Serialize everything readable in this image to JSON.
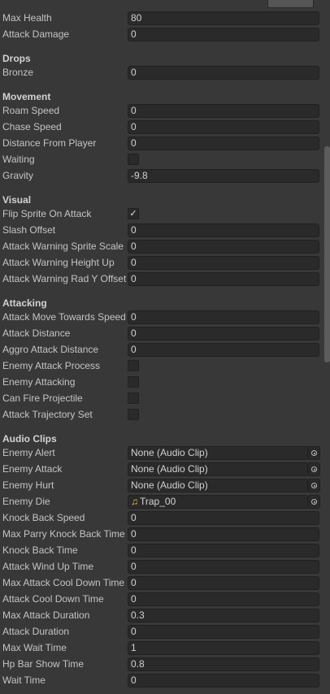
{
  "stats": {
    "max_health_label": "Max Health",
    "max_health_value": "80",
    "attack_damage_label": "Attack Damage",
    "attack_damage_value": "0"
  },
  "drops": {
    "header": "Drops",
    "bronze_label": "Bronze",
    "bronze_value": "0"
  },
  "movement": {
    "header": "Movement",
    "roam_speed_label": "Roam Speed",
    "roam_speed_value": "0",
    "chase_speed_label": "Chase Speed",
    "chase_speed_value": "0",
    "distance_from_player_label": "Distance From Player",
    "distance_from_player_value": "0",
    "waiting_label": "Waiting",
    "waiting_checked": false,
    "gravity_label": "Gravity",
    "gravity_value": "-9.8"
  },
  "visual": {
    "header": "Visual",
    "flip_sprite_label": "Flip Sprite On Attack",
    "flip_sprite_checked": true,
    "flip_sprite_mark": "✓",
    "slash_offset_label": "Slash Offset",
    "slash_offset_value": "0",
    "warning_sprite_scale_label": "Attack Warning Sprite Scale",
    "warning_sprite_scale_value": "0",
    "warning_height_up_label": "Attack Warning Height Up",
    "warning_height_up_value": "0",
    "warning_rad_y_label": "Attack Warning Rad Y Offset",
    "warning_rad_y_value": "0"
  },
  "attacking": {
    "header": "Attacking",
    "move_towards_label": "Attack Move Towards Speed",
    "move_towards_value": "0",
    "attack_distance_label": "Attack Distance",
    "attack_distance_value": "0",
    "aggro_distance_label": "Aggro Attack Distance",
    "aggro_distance_value": "0",
    "attack_process_label": "Enemy Attack Process",
    "attack_process_checked": false,
    "enemy_attacking_label": "Enemy Attacking",
    "enemy_attacking_checked": false,
    "fire_projectile_label": "Can Fire Projectile",
    "fire_projectile_checked": false,
    "trajectory_set_label": "Attack Trajectory Set",
    "trajectory_set_checked": false
  },
  "audio": {
    "header": "Audio Clips",
    "enemy_alert_label": "Enemy Alert",
    "enemy_alert_value": "None (Audio Clip)",
    "enemy_attack_label": "Enemy Attack",
    "enemy_attack_value": "None (Audio Clip)",
    "enemy_hurt_label": "Enemy Hurt",
    "enemy_hurt_value": "None (Audio Clip)",
    "enemy_die_label": "Enemy Die",
    "enemy_die_icon": "♫",
    "enemy_die_value": "Trap_00"
  },
  "timing": {
    "knock_back_speed_label": "Knock Back Speed",
    "knock_back_speed_value": "0",
    "max_parry_label": "Max Parry Knock Back Time",
    "max_parry_value": "0",
    "knock_back_time_label": "Knock Back Time",
    "knock_back_time_value": "0",
    "wind_up_label": "Attack Wind Up Time",
    "wind_up_value": "0",
    "max_cooldown_label": "Max Attack Cool Down Time",
    "max_cooldown_value": "0",
    "cooldown_label": "Attack Cool Down Time",
    "cooldown_value": "0",
    "max_duration_label": "Max Attack Duration",
    "max_duration_value": "0.3",
    "duration_label": "Attack Duration",
    "duration_value": "0",
    "max_wait_label": "Max Wait Time",
    "max_wait_value": "1",
    "hp_bar_label": "Hp Bar Show Time",
    "hp_bar_value": "0.8",
    "wait_time_label": "Wait Time",
    "wait_time_value": "0"
  }
}
